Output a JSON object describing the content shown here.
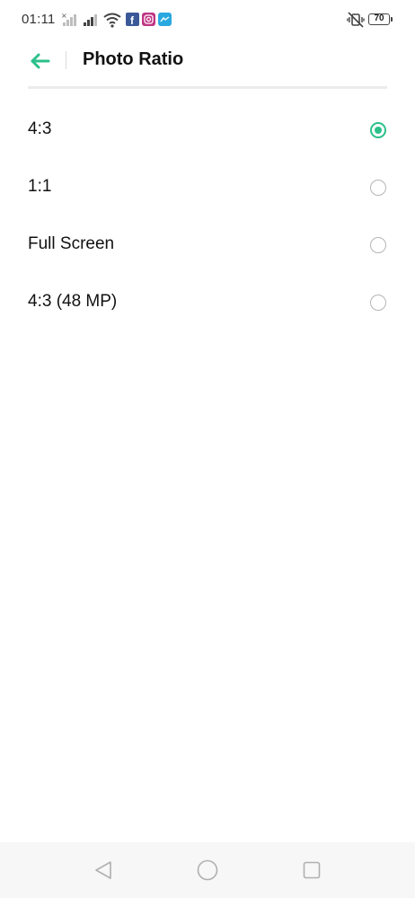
{
  "status_bar": {
    "time": "01:11",
    "battery_level": "70",
    "icons": [
      "signal-no-service-icon",
      "signal-icon",
      "wifi-icon",
      "facebook-icon",
      "instagram-icon",
      "messenger-icon",
      "vibrate-icon",
      "battery-icon"
    ]
  },
  "header": {
    "title": "Photo Ratio",
    "back_icon": "arrow-left-icon"
  },
  "options": [
    {
      "label": "4:3",
      "selected": true
    },
    {
      "label": "1:1",
      "selected": false
    },
    {
      "label": "Full Screen",
      "selected": false
    },
    {
      "label": "4:3 (48 MP)",
      "selected": false
    }
  ],
  "colors": {
    "accent": "#2cc08a",
    "radio_off": "#b5b5b5",
    "nav_bar_bg": "#f7f7f7"
  },
  "nav_bar": {
    "icons": [
      "nav-back-icon",
      "nav-home-icon",
      "nav-recents-icon"
    ]
  }
}
